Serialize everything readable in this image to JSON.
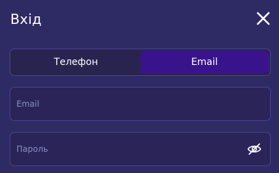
{
  "dialog": {
    "title": "Вхід",
    "close_icon": "close-icon"
  },
  "tabs": [
    {
      "label": "Телефон",
      "active": false
    },
    {
      "label": "Email",
      "active": true
    }
  ],
  "email_field": {
    "placeholder": "Email",
    "value": ""
  },
  "password_field": {
    "placeholder": "Пароль",
    "value": "",
    "toggle_icon": "eye-off-icon"
  },
  "colors": {
    "background": "#2e2a63",
    "active_tab": "#39138c",
    "border": "#4a4590",
    "placeholder": "#8a8fc2"
  }
}
